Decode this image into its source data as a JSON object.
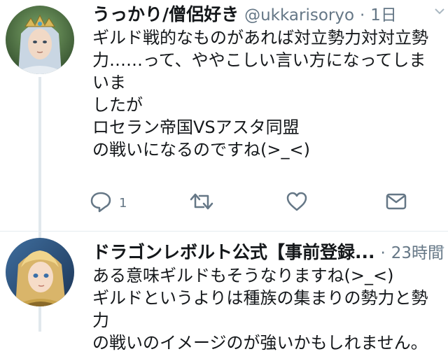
{
  "tweets": [
    {
      "author_name": "うっかり/僧侶好き",
      "handle": "@ukkarisoryo",
      "separator": "·",
      "time": "1日",
      "body": [
        "ギルド戦的なものがあれば対立勢力対対立勢",
        "力……って、ややこしい言い方になってしまいま",
        "したが",
        "",
        "ロセラン帝国VSアスタ同盟",
        "",
        "の戦いになるのですね(>_<)"
      ],
      "actions": {
        "reply_count": "1",
        "retweet_count": "",
        "like_count": ""
      }
    },
    {
      "author_name": "ドラゴンレボルト公式【事前登録...",
      "separator": "·",
      "time": "23時間",
      "body": [
        "ある意味ギルドもそうなりますね(>_<)",
        "ギルドというよりは種族の集まりの勢力と勢力",
        "の戦いのイメージのが強いかもしれません。"
      ]
    }
  ],
  "icons": {
    "reply": "reply-icon",
    "retweet": "retweet-icon",
    "like": "like-icon",
    "dm": "direct-message-icon",
    "caret": "chevron-down-icon"
  },
  "colors": {
    "text": "#14171a",
    "secondary": "#657786",
    "thread_line": "#e1e8ed"
  }
}
